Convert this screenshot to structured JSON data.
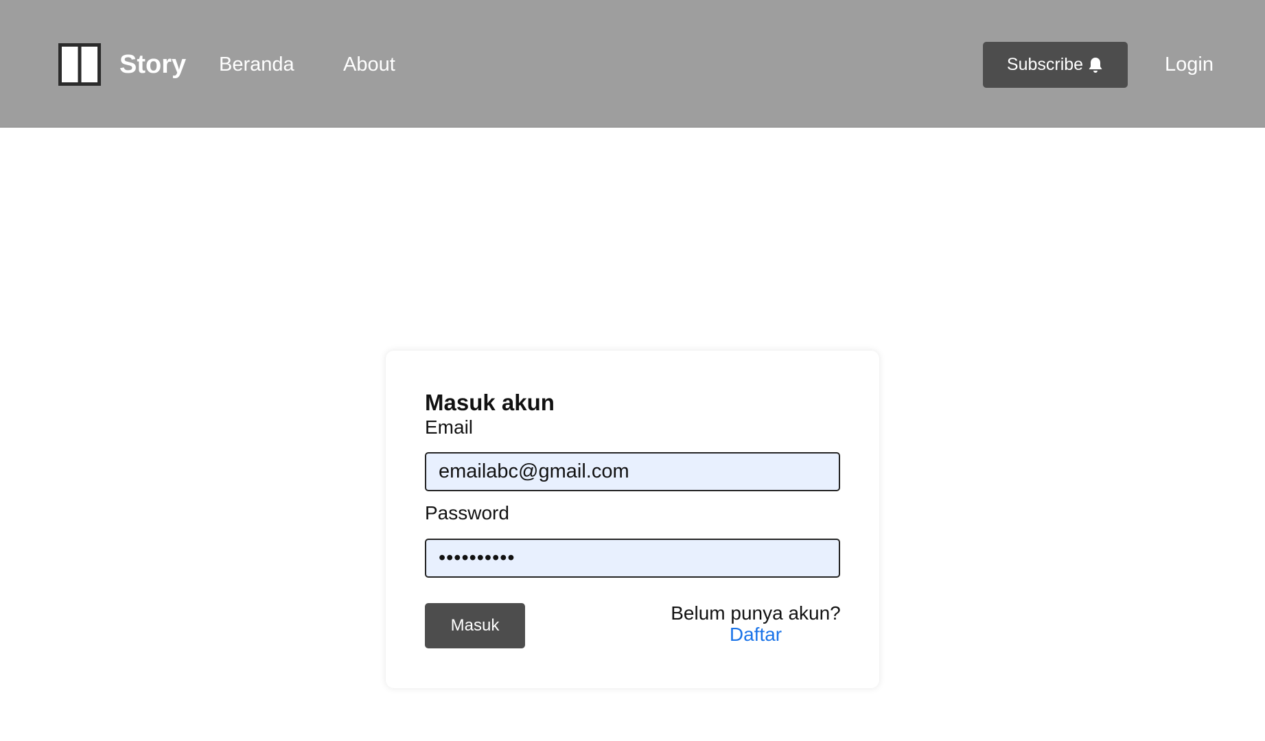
{
  "navbar": {
    "brand_name": "Story",
    "links": [
      {
        "label": "Beranda"
      },
      {
        "label": "About"
      }
    ],
    "subscribe_label": "Subscribe",
    "login_label": "Login",
    "icons": {
      "brand": "book-icon",
      "subscribe": "bell-icon"
    },
    "background_color": "#9e9e9e"
  },
  "login_form": {
    "title": "Masuk akun",
    "email_label": "Email",
    "email_value": "emailabc@gmail.com",
    "password_label": "Password",
    "password_value": "••••••••••",
    "submit_label": "Masuk",
    "register_prompt": "Belum punya akun?",
    "register_link": "Daftar"
  },
  "colors": {
    "button_dark": "#4d4d4d",
    "input_fill": "#e8f0fe",
    "link_blue": "#1a73e8"
  }
}
